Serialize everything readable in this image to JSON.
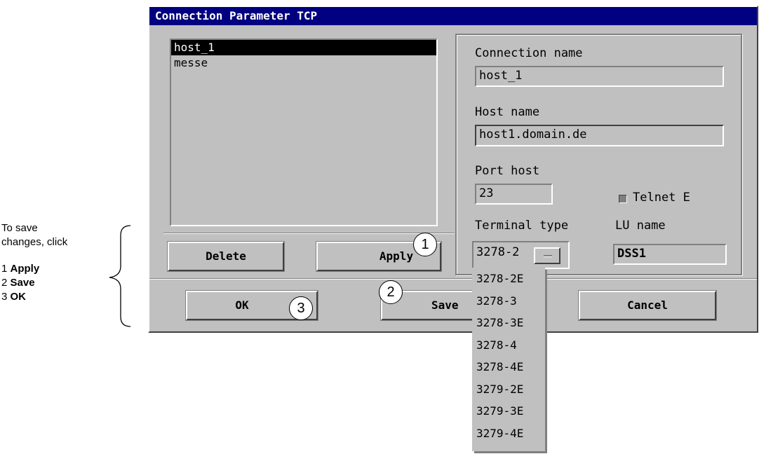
{
  "annotation": {
    "intro_line1": "To save",
    "intro_line2": "changes, click",
    "steps": [
      {
        "num": "1",
        "label": "Apply"
      },
      {
        "num": "2",
        "label": "Save"
      },
      {
        "num": "3",
        "label": "OK"
      }
    ]
  },
  "dialog": {
    "title": "Connection Parameter TCP",
    "connections": [
      "host_1",
      "messe"
    ],
    "selected_connection": "host_1",
    "fields": {
      "connection_name_label": "Connection name",
      "connection_name_value": "host_1",
      "host_name_label": "Host name",
      "host_name_value": "host1.domain.de",
      "port_host_label": "Port host",
      "port_host_value": "23",
      "telnet_label": "Telnet E",
      "terminal_type_label": "Terminal type",
      "terminal_type_value": "3278-2",
      "lu_name_label": "LU name",
      "lu_name_value": "DSS1"
    },
    "buttons": {
      "delete": "Delete",
      "apply": "Apply",
      "ok": "OK",
      "save": "Save",
      "cancel": "Cancel"
    },
    "terminal_type_options": [
      "3278-2E",
      "3278-3",
      "3278-3E",
      "3278-4",
      "3278-4E",
      "3279-2E",
      "3279-3E",
      "3279-4E"
    ]
  },
  "callouts": [
    "1",
    "2",
    "3"
  ],
  "colors": {
    "titlebar": "#000080",
    "face": "#c0c0c0",
    "selection": "#000000"
  }
}
